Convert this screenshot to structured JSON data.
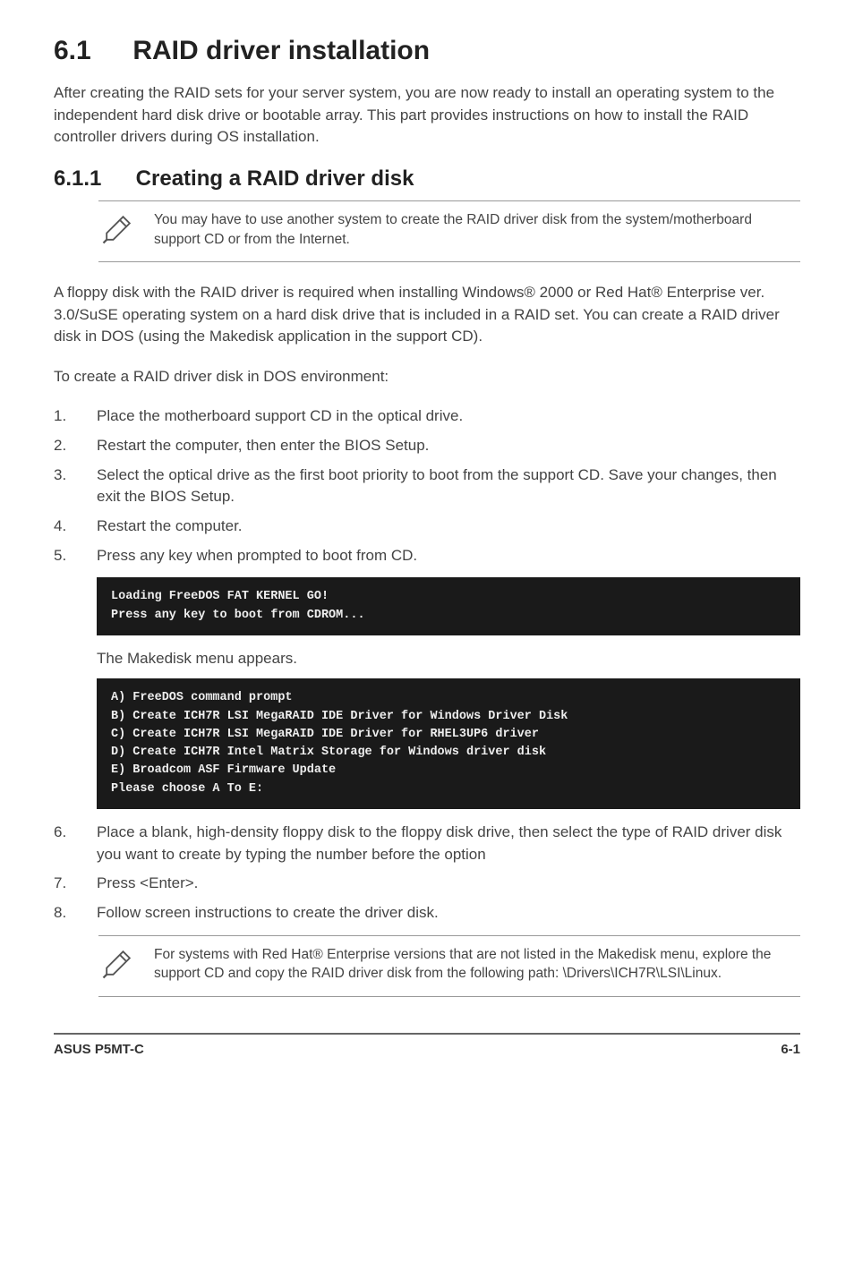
{
  "section": {
    "number": "6.1",
    "title": "RAID driver installation",
    "intro": "After creating the RAID sets for your server system, you are now ready to install an operating system to the independent hard disk drive or bootable array. This part provides instructions on how to install the RAID controller drivers during OS installation."
  },
  "subsection": {
    "number": "6.1.1",
    "title": "Creating a RAID driver disk"
  },
  "note1": "You may have to use another system to create the RAID driver disk from the system/motherboard support CD or from the Internet.",
  "para1": "A floppy disk with the RAID driver is required when installing Windows® 2000 or Red Hat® Enterprise ver. 3.0/SuSE operating system on a hard disk drive that is included in a RAID set. You can create a RAID driver disk in DOS (using the Makedisk application in the support CD).",
  "para2": "To create a RAID driver disk in DOS environment:",
  "steps1": {
    "s1": "Place the motherboard support CD in the optical drive.",
    "s2": "Restart the computer, then enter the BIOS Setup.",
    "s3": "Select the optical drive as the first boot priority to boot from the support CD. Save your changes, then exit the BIOS Setup.",
    "s4": "Restart the computer.",
    "s5": "Press any key when prompted to boot from CD."
  },
  "terminal1": "Loading FreeDOS FAT KERNEL GO!\nPress any key to boot from CDROM...",
  "para3": "The Makedisk menu appears.",
  "terminal2": "A) FreeDOS command prompt\nB) Create ICH7R LSI MegaRAID IDE Driver for Windows Driver Disk\nC) Create ICH7R LSI MegaRAID IDE Driver for RHEL3UP6 driver\nD) Create ICH7R Intel Matrix Storage for Windows driver disk\nE) Broadcom ASF Firmware Update\nPlease choose A To E:",
  "steps2": {
    "s6": "Place a blank, high-density floppy disk to the floppy disk drive, then select the type of RAID driver disk you want to create by typing the number before the option",
    "s7": "Press <Enter>.",
    "s8": "Follow screen instructions to create the driver disk."
  },
  "note2": "For systems with Red Hat® Enterprise versions that are not listed in the Makedisk menu, explore the support CD and copy the RAID driver disk from the following path: \\Drivers\\ICH7R\\LSI\\Linux.",
  "footer": {
    "left": "ASUS P5MT-C",
    "right": "6-1"
  }
}
